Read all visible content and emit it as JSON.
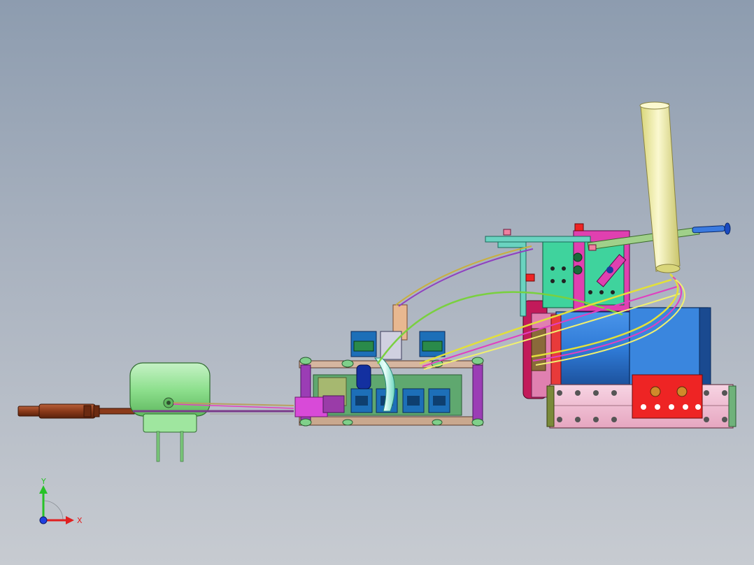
{
  "viewport": {
    "background_top": "#8d9caf",
    "background_bottom": "#c7cbd1"
  },
  "triad": {
    "y_label": "Y",
    "x_label": "X",
    "y_color": "#27c227",
    "x_color": "#e02020",
    "z_color": "#1f3fe0"
  },
  "model": {
    "icons": [
      "usb-cable",
      "power-adapter",
      "controller-board",
      "rj11-ports",
      "wire-harness",
      "servo-motor",
      "bracket-assembly",
      "yellow-tube",
      "blue-screw",
      "pink-base-plate"
    ],
    "colors": {
      "adapter": "#8ee08e",
      "cable": "#8b3a1a",
      "board": "#6fb27a",
      "frame": "#9b3db5",
      "port": "#1d6fb8",
      "motor": "#2f7ad6",
      "red_part": "#ee2424",
      "pink_base": "#f0b9cf",
      "green_bracket": "#3fd39d",
      "yellow_tube": "#f2f0a8"
    }
  }
}
